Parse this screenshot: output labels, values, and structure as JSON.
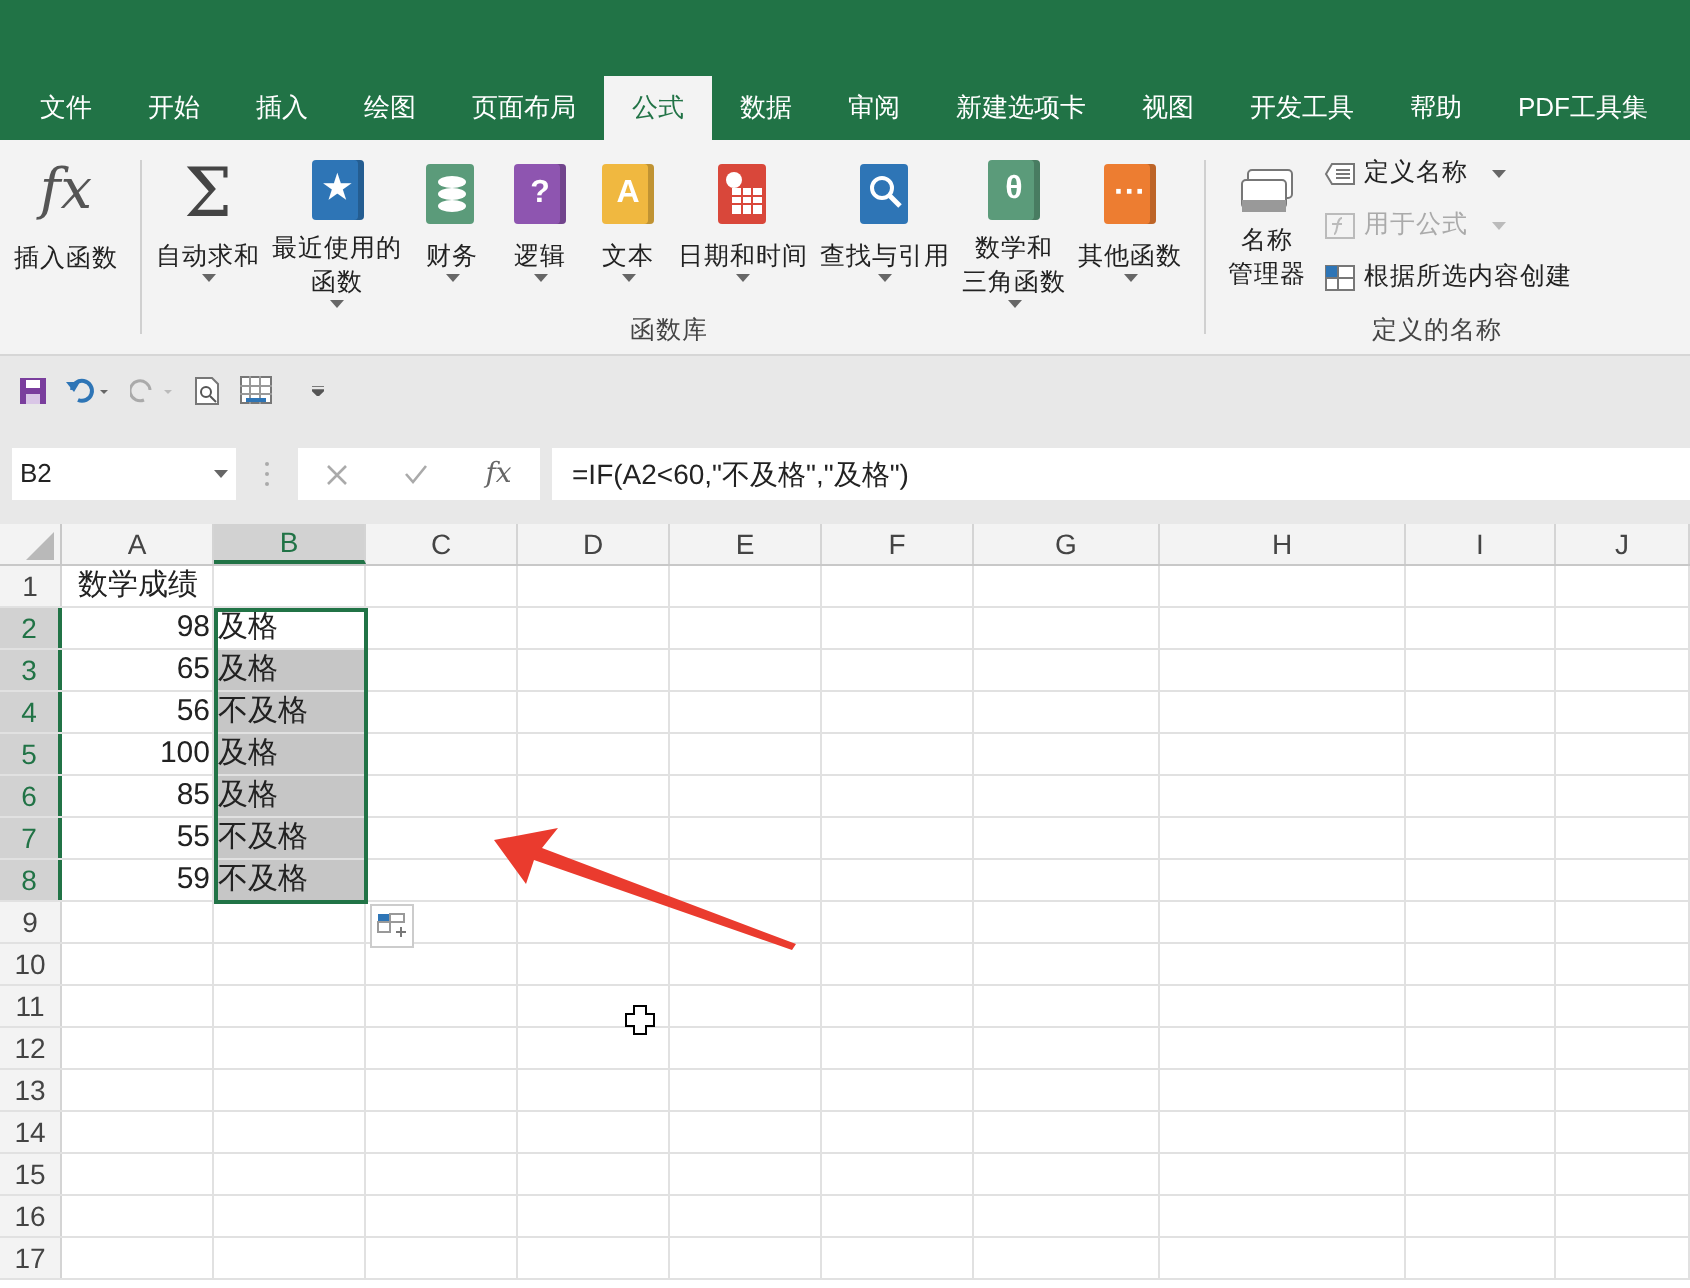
{
  "tabs": [
    {
      "label": "文件",
      "selected": false
    },
    {
      "label": "开始",
      "selected": false
    },
    {
      "label": "插入",
      "selected": false
    },
    {
      "label": "绘图",
      "selected": false
    },
    {
      "label": "页面布局",
      "selected": false
    },
    {
      "label": "公式",
      "selected": true
    },
    {
      "label": "数据",
      "selected": false
    },
    {
      "label": "审阅",
      "selected": false
    },
    {
      "label": "新建选项卡",
      "selected": false
    },
    {
      "label": "视图",
      "selected": false
    },
    {
      "label": "开发工具",
      "selected": false
    },
    {
      "label": "帮助",
      "selected": false
    },
    {
      "label": "PDF工具集",
      "selected": false
    }
  ],
  "ribbon": {
    "insert_function": {
      "symbol": "fx",
      "lines": [
        "插入函数"
      ]
    },
    "function_library": {
      "label": "函数库",
      "buttons": [
        {
          "kind": "sigma",
          "symbol": "Σ",
          "lines": [
            "自动求和"
          ],
          "caret": true
        },
        {
          "kind": "book",
          "glyph": "★",
          "color": "#2e75b6",
          "lines": [
            "最近使用的",
            "函数"
          ],
          "caret": true
        },
        {
          "kind": "coins",
          "color": "#5b9b7a",
          "lines": [
            "财务"
          ],
          "caret": true
        },
        {
          "kind": "book",
          "glyph": "?",
          "color": "#8e55b0",
          "lines": [
            "逻辑"
          ],
          "caret": true
        },
        {
          "kind": "book",
          "glyph": "A",
          "color": "#f0b840",
          "lines": [
            "文本"
          ],
          "caret": true
        },
        {
          "kind": "calendar",
          "color": "#d9473a",
          "lines": [
            "日期和时间"
          ],
          "caret": true
        },
        {
          "kind": "magnifier",
          "color": "#2e75b6",
          "lines": [
            "查找与引用"
          ],
          "caret": true
        },
        {
          "kind": "book",
          "glyph": "θ",
          "color": "#5b9b7a",
          "lines": [
            "数学和",
            "三角函数"
          ],
          "caret": true
        },
        {
          "kind": "book",
          "glyph": "···",
          "color": "#ed7d31",
          "lines": [
            "其他函数"
          ],
          "caret": true
        }
      ]
    },
    "defined_names": {
      "label": "定义的名称",
      "manager": {
        "lines": [
          "名称",
          "管理器"
        ]
      },
      "items": [
        {
          "kind": "tag",
          "label": "定义名称",
          "caret": true,
          "disabled": false
        },
        {
          "kind": "fx",
          "label": "用于公式",
          "caret": true,
          "disabled": true
        },
        {
          "kind": "table",
          "label": "根据所选内容创建",
          "caret": false,
          "disabled": false
        }
      ]
    }
  },
  "formula_bar": {
    "name_box": "B2",
    "fx_label": "fx",
    "formula": "=IF(A2<60,\"不及格\",\"及格\")"
  },
  "sheet": {
    "columns": [
      {
        "label": "A",
        "selected": false
      },
      {
        "label": "B",
        "selected": true
      },
      {
        "label": "C",
        "selected": false
      },
      {
        "label": "D",
        "selected": false
      },
      {
        "label": "E",
        "selected": false
      },
      {
        "label": "F",
        "selected": false
      },
      {
        "label": "G",
        "selected": false
      },
      {
        "label": "H",
        "selected": false
      },
      {
        "label": "I",
        "selected": false
      },
      {
        "label": "J",
        "selected": false
      }
    ],
    "rows": [
      {
        "header": "1",
        "selected": false,
        "cells": [
          {
            "kind": "heading",
            "text": "数学成绩"
          }
        ]
      },
      {
        "header": "2",
        "selected": true,
        "cells": [
          {
            "kind": "number",
            "text": "98"
          },
          {
            "kind": "text",
            "text": "及格",
            "selected": false
          }
        ]
      },
      {
        "header": "3",
        "selected": true,
        "cells": [
          {
            "kind": "number",
            "text": "65"
          },
          {
            "kind": "text",
            "text": "及格",
            "selected": true
          }
        ]
      },
      {
        "header": "4",
        "selected": true,
        "cells": [
          {
            "kind": "number",
            "text": "56"
          },
          {
            "kind": "text",
            "text": "不及格",
            "selected": true
          }
        ]
      },
      {
        "header": "5",
        "selected": true,
        "cells": [
          {
            "kind": "number",
            "text": "100"
          },
          {
            "kind": "text",
            "text": "及格",
            "selected": true
          }
        ]
      },
      {
        "header": "6",
        "selected": true,
        "cells": [
          {
            "kind": "number",
            "text": "85"
          },
          {
            "kind": "text",
            "text": "及格",
            "selected": true
          }
        ]
      },
      {
        "header": "7",
        "selected": true,
        "cells": [
          {
            "kind": "number",
            "text": "55"
          },
          {
            "kind": "text",
            "text": "不及格",
            "selected": true
          }
        ]
      },
      {
        "header": "8",
        "selected": true,
        "cells": [
          {
            "kind": "number",
            "text": "59"
          },
          {
            "kind": "text",
            "text": "不及格",
            "selected": true
          }
        ]
      },
      {
        "header": "9",
        "selected": false,
        "cells": []
      },
      {
        "header": "10",
        "selected": false,
        "cells": []
      },
      {
        "header": "11",
        "selected": false,
        "cells": []
      },
      {
        "header": "12",
        "selected": false,
        "cells": []
      },
      {
        "header": "13",
        "selected": false,
        "cells": []
      },
      {
        "header": "14",
        "selected": false,
        "cells": []
      },
      {
        "header": "15",
        "selected": false,
        "cells": []
      },
      {
        "header": "16",
        "selected": false,
        "cells": []
      },
      {
        "header": "17",
        "selected": false,
        "cells": []
      }
    ]
  }
}
